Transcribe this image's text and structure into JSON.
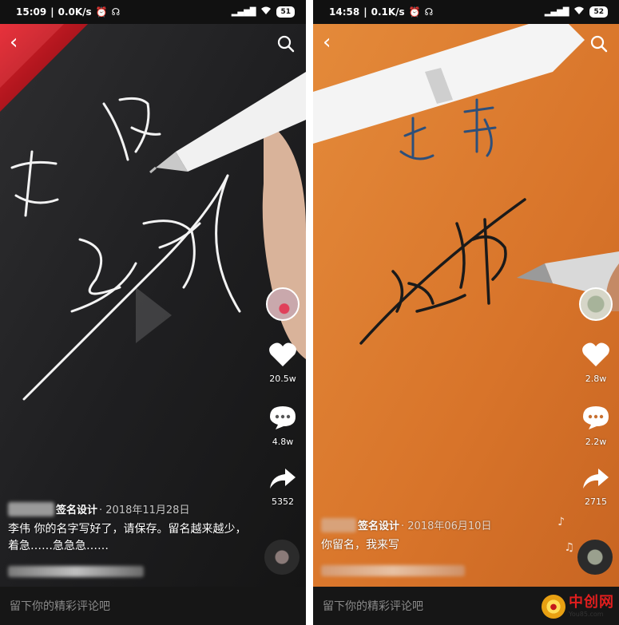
{
  "screens": [
    {
      "status": {
        "time": "15:09",
        "speed": "0.0K/s",
        "battery": "51"
      },
      "video": {
        "signature_title": "李伟",
        "theme": "dark"
      },
      "stats": {
        "likes": "20.5w",
        "comments": "4.8w",
        "shares": "5352"
      },
      "author": {
        "name": "签名设计",
        "date": "· 2018年11月28日"
      },
      "description": "李伟 你的名字写好了，请保存。留名越来越少，着急……急急急……",
      "comment_placeholder": "留下你的精彩评论吧"
    },
    {
      "status": {
        "time": "14:58",
        "speed": "0.1K/s",
        "battery": "52"
      },
      "video": {
        "signature_title": "赵 静",
        "theme": "orange"
      },
      "stats": {
        "likes": "2.8w",
        "comments": "2.2w",
        "shares": "2715"
      },
      "author": {
        "name": "签名设计",
        "date": "· 2018年06月10日"
      },
      "description": "你留名，我来写",
      "comment_placeholder": "留下你的精彩评论吧"
    }
  ],
  "icons": {
    "back": "chevron-left-icon",
    "search": "search-icon",
    "like": "heart-icon",
    "comment": "comment-icon",
    "share": "share-arrow-icon",
    "music": "music-note-icon"
  },
  "watermark": {
    "title": "中创网",
    "url": "You85.com"
  },
  "colors": {
    "orange_bg": "#e07a2a",
    "dark_bg": "#1c1c1e",
    "watermark_red": "#e01e1e"
  }
}
